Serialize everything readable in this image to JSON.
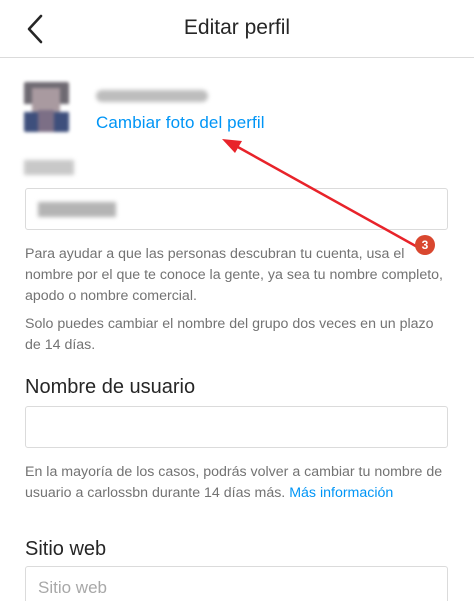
{
  "header": {
    "title": "Editar perfil",
    "back_icon": "chevron-left-icon"
  },
  "profile": {
    "change_photo_label": "Cambiar foto del perfil"
  },
  "name_section": {
    "help_text": "Para ayudar a que las personas descubran tu cuenta, usa el nombre por el que te conoce la gente, ya sea tu nombre completo, apodo o nombre comercial.",
    "limit_text": "Solo puedes cambiar el nombre del grupo dos veces en un plazo de 14 días."
  },
  "username_section": {
    "title": "Nombre de usuario",
    "value": "",
    "help_text": "En la mayoría de los casos, podrás volver a cambiar tu nombre de usuario a carlossbn durante 14 días más.",
    "more_info_link": "Más información"
  },
  "website_section": {
    "title": "Sitio web",
    "placeholder": "Sitio web"
  },
  "annotation": {
    "step_number": "3",
    "color": "#e8232a"
  },
  "colors": {
    "link": "#0095f6",
    "text": "#262626",
    "secondary_text": "#737373",
    "border": "#dbdbdb"
  }
}
